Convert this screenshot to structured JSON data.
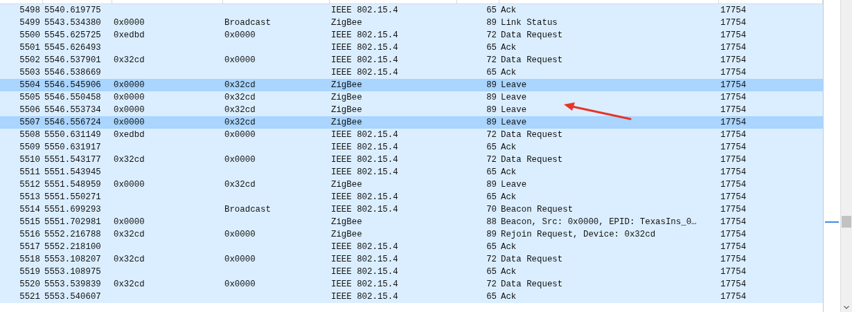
{
  "packet_list": {
    "rows": [
      {
        "no": "5498",
        "time": "5540.619775",
        "protocol": "IEEE 802.15.4",
        "length": "65",
        "info": "Ack",
        "column_8": "17754",
        "selected": false
      },
      {
        "no": "5499",
        "time": "5543.534380",
        "source": "0x0000",
        "destination": "Broadcast",
        "protocol": "ZigBee",
        "length": "89",
        "info": "Link Status",
        "column_8": "17754",
        "selected": false
      },
      {
        "no": "5500",
        "time": "5545.625725",
        "source": "0xedbd",
        "destination": "0x0000",
        "protocol": "IEEE 802.15.4",
        "length": "72",
        "info": "Data Request",
        "column_8": "17754",
        "selected": false
      },
      {
        "no": "5501",
        "time": "5545.626493",
        "protocol": "IEEE 802.15.4",
        "length": "65",
        "info": "Ack",
        "column_8": "17754",
        "selected": false
      },
      {
        "no": "5502",
        "time": "5546.537901",
        "source": "0x32cd",
        "destination": "0x0000",
        "protocol": "IEEE 802.15.4",
        "length": "72",
        "info": "Data Request",
        "column_8": "17754",
        "selected": false
      },
      {
        "no": "5503",
        "time": "5546.538669",
        "protocol": "IEEE 802.15.4",
        "length": "65",
        "info": "Ack",
        "column_8": "17754",
        "selected": false
      },
      {
        "no": "5504",
        "time": "5546.545906",
        "source": "0x0000",
        "destination": "0x32cd",
        "protocol": "ZigBee",
        "length": "89",
        "info": "Leave",
        "column_8": "17754",
        "selected": true
      },
      {
        "no": "5505",
        "time": "5546.550458",
        "source": "0x0000",
        "destination": "0x32cd",
        "protocol": "ZigBee",
        "length": "89",
        "info": "Leave",
        "column_8": "17754",
        "selected": false
      },
      {
        "no": "5506",
        "time": "5546.553734",
        "source": "0x0000",
        "destination": "0x32cd",
        "protocol": "ZigBee",
        "length": "89",
        "info": "Leave",
        "column_8": "17754",
        "selected": false
      },
      {
        "no": "5507",
        "time": "5546.556724",
        "source": "0x0000",
        "destination": "0x32cd",
        "protocol": "ZigBee",
        "length": "89",
        "info": "Leave",
        "column_8": "17754",
        "selected": true
      },
      {
        "no": "5508",
        "time": "5550.631149",
        "source": "0xedbd",
        "destination": "0x0000",
        "protocol": "IEEE 802.15.4",
        "length": "72",
        "info": "Data Request",
        "column_8": "17754",
        "selected": false
      },
      {
        "no": "5509",
        "time": "5550.631917",
        "protocol": "IEEE 802.15.4",
        "length": "65",
        "info": "Ack",
        "column_8": "17754",
        "selected": false
      },
      {
        "no": "5510",
        "time": "5551.543177",
        "source": "0x32cd",
        "destination": "0x0000",
        "protocol": "IEEE 802.15.4",
        "length": "72",
        "info": "Data Request",
        "column_8": "17754",
        "selected": false
      },
      {
        "no": "5511",
        "time": "5551.543945",
        "protocol": "IEEE 802.15.4",
        "length": "65",
        "info": "Ack",
        "column_8": "17754",
        "selected": false
      },
      {
        "no": "5512",
        "time": "5551.548959",
        "source": "0x0000",
        "destination": "0x32cd",
        "protocol": "ZigBee",
        "length": "89",
        "info": "Leave",
        "column_8": "17754",
        "selected": false
      },
      {
        "no": "5513",
        "time": "5551.550271",
        "protocol": "IEEE 802.15.4",
        "length": "65",
        "info": "Ack",
        "column_8": "17754",
        "selected": false
      },
      {
        "no": "5514",
        "time": "5551.699293",
        "destination": "Broadcast",
        "protocol": "IEEE 802.15.4",
        "length": "70",
        "info": "Beacon Request",
        "column_8": "17754",
        "selected": false
      },
      {
        "no": "5515",
        "time": "5551.702981",
        "source": "0x0000",
        "protocol": "ZigBee",
        "length": "88",
        "info": "Beacon, Src: 0x0000, EPID: TexasIns_0…",
        "column_8": "17754",
        "selected": false
      },
      {
        "no": "5516",
        "time": "5552.216788",
        "source": "0x32cd",
        "destination": "0x0000",
        "protocol": "ZigBee",
        "length": "89",
        "info": "Rejoin Request, Device: 0x32cd",
        "column_8": "17754",
        "selected": false
      },
      {
        "no": "5517",
        "time": "5552.218100",
        "protocol": "IEEE 802.15.4",
        "length": "65",
        "info": "Ack",
        "column_8": "17754",
        "selected": false
      },
      {
        "no": "5518",
        "time": "5553.108207",
        "source": "0x32cd",
        "destination": "0x0000",
        "protocol": "IEEE 802.15.4",
        "length": "72",
        "info": "Data Request",
        "column_8": "17754",
        "selected": false
      },
      {
        "no": "5519",
        "time": "5553.108975",
        "protocol": "IEEE 802.15.4",
        "length": "65",
        "info": "Ack",
        "column_8": "17754",
        "selected": false
      },
      {
        "no": "5520",
        "time": "5553.539839",
        "source": "0x32cd",
        "destination": "0x0000",
        "protocol": "IEEE 802.15.4",
        "length": "72",
        "info": "Data Request",
        "column_8": "17754",
        "selected": false
      },
      {
        "no": "5521",
        "time": "5553.540607",
        "protocol": "IEEE 802.15.4",
        "length": "65",
        "info": "Ack",
        "column_8": "17754",
        "selected": false
      }
    ]
  }
}
